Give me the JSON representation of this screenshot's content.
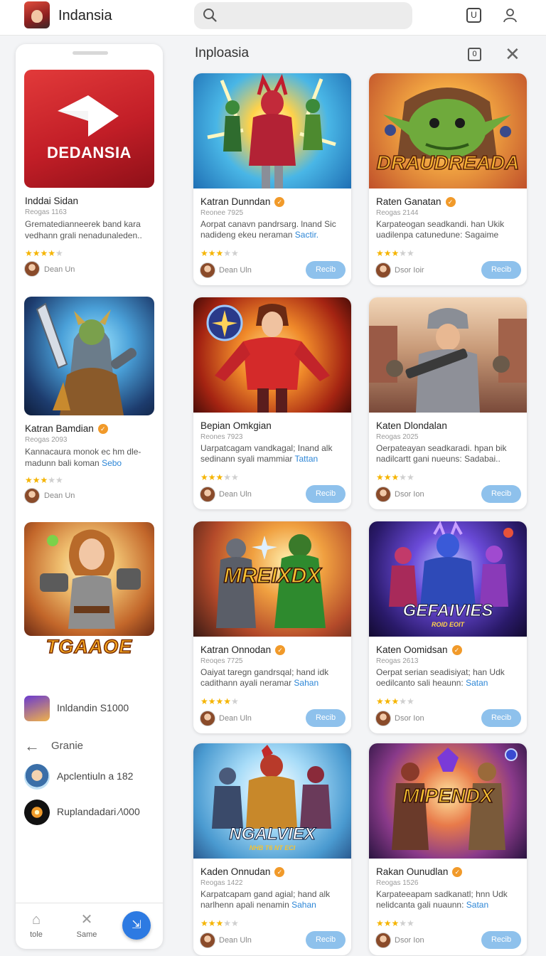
{
  "app": {
    "title": "Indansia"
  },
  "search": {
    "placeholder": ""
  },
  "topbar": {
    "box_label": "U"
  },
  "left": {
    "cards": [
      {
        "logo_text": "DEDANSIA",
        "title": "Inddai Sidan",
        "meta": "Reogas 1163",
        "desc": "Grematedianneerek band kara vedhann grali nenadunaleden..",
        "desc_link": "",
        "rating": 4,
        "author": "Dean Un",
        "verified": false
      },
      {
        "title": "Katran Bamdian",
        "meta": "Reogas 2093",
        "desc": "Kannacaura monok ec hm dle-madunn bali koman ",
        "desc_link": "Sebo",
        "rating": 3,
        "author": "Dean Un",
        "verified": true
      }
    ],
    "promo_logo": "TGAAOE",
    "list": [
      {
        "label": "Inldandin S1000"
      },
      {
        "label": "Apclentiuln a 182"
      },
      {
        "label": "Ruplandadari ∕\\000"
      }
    ],
    "back_label": "Granie",
    "nav": [
      {
        "label": "tole"
      },
      {
        "label": "Same"
      }
    ]
  },
  "main": {
    "title": "Inploasia",
    "box_label": "0",
    "cards": [
      {
        "title": "Katran Dunndan",
        "meta": "Reonee 7925",
        "desc": "Aorpat canavn pandrsarg. lnand Sic nadideng ekeu neraman ",
        "link": "Sactir.",
        "rating": 3,
        "author": "Dean Uln",
        "button": "Recib"
      },
      {
        "title": "Raten Ganatan",
        "meta": "Reogas 2144",
        "desc": "Karpateogan seadkandi. han Ukik uadilenpa catunedune: Sagaime",
        "link": "",
        "rating": 3,
        "author": "Dsor Ioir",
        "button": "Recib",
        "art_text": "DRAUDREADA"
      },
      {
        "title": "Bepian Omkgian",
        "meta": "Reones 7923",
        "desc": "Uarpatcagam vandkagal; Inand alk sedinann syali mammiar ",
        "link": "Tattan",
        "rating": 3,
        "author": "Dean Uln",
        "button": "Recib"
      },
      {
        "title": "Katen Dlondalan",
        "meta": "Reogas 2025",
        "desc": "Oerpateayan seadkaradi. hpan bik nadilcartt gani nueuns: Sadabai..",
        "link": "",
        "rating": 3,
        "author": "Dsor Ion",
        "button": "Recib"
      },
      {
        "title": "Katran Onnodan",
        "meta": "Reoqes 7725",
        "desc": "Oaiyat taregn gandrsqal; hand idk cadithann ayali neramar ",
        "link": "Sahan",
        "rating": 4,
        "author": "Dean Uln",
        "button": "Recib",
        "art_text": "MREIXDX"
      },
      {
        "title": "Katen Oomidsan",
        "meta": "Reogas 2613",
        "desc": "Oerpat serian seadisiyat; han Udk oedilcanto sali heaunn: ",
        "link": "Satan",
        "rating": 3,
        "author": "Dsor Ion",
        "button": "Recib",
        "art_text": "GEFAIVIES",
        "art_sub": "ROID EOIT"
      },
      {
        "title": "Kaden Onnudan",
        "meta": "Reogas 1422",
        "desc": "Karpatcapam gand agial; hand alk narlhenn apali nenamin ",
        "link": "Sahan",
        "rating": 3,
        "author": "Dean Uln",
        "button": "Recib",
        "art_text": "NGALVIEX",
        "art_sub": "NHB T6 NT ECI"
      },
      {
        "title": "Rakan Ounudlan",
        "meta": "Reogas 1526",
        "desc": "Karpateeapam sadkanatl; hnn Udk nelidcanta gali nuaunn: ",
        "link": "Satan",
        "rating": 3,
        "author": "Dsor Ion",
        "button": "Recib",
        "art_text": "MIPENDX"
      }
    ]
  },
  "colors": {
    "accent": "#2d7ae2",
    "button": "#8ec1ec",
    "star": "#f5b400",
    "verified": "#f19a2a",
    "link": "#2d86d6"
  }
}
